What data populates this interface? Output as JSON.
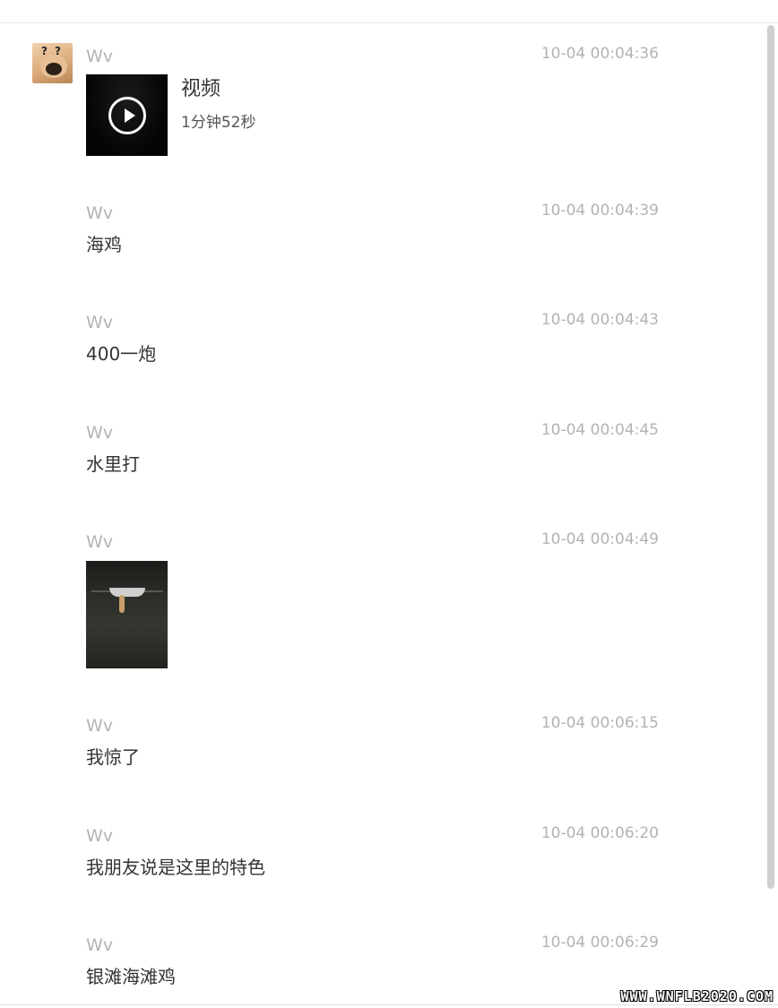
{
  "messages": [
    {
      "sender": "Wv",
      "time": "10-04 00:04:36",
      "type": "video",
      "video_title": "视频",
      "video_duration": "1分钟52秒",
      "video_icon": "play-circle-icon"
    },
    {
      "sender": "Wv",
      "time": "10-04 00:04:39",
      "type": "text",
      "text": "海鸡"
    },
    {
      "sender": "Wv",
      "time": "10-04 00:04:43",
      "type": "text",
      "text": "400一炮"
    },
    {
      "sender": "Wv",
      "time": "10-04 00:04:45",
      "type": "text",
      "text": "水里打"
    },
    {
      "sender": "Wv",
      "time": "10-04 00:04:49",
      "type": "image"
    },
    {
      "sender": "Wv",
      "time": "10-04 00:06:15",
      "type": "text",
      "text": "我惊了"
    },
    {
      "sender": "Wv",
      "time": "10-04 00:06:20",
      "type": "text",
      "text": "我朋友说是这里的特色"
    },
    {
      "sender": "Wv",
      "time": "10-04 00:06:29",
      "type": "text",
      "text": "银滩海滩鸡"
    }
  ],
  "watermark": "WWW.WNFLB2020.COM",
  "colors": {
    "meta_text": "#b3b3b3",
    "body_text": "#333333",
    "background": "#ffffff",
    "scrollbar": "#cfcfcf"
  }
}
